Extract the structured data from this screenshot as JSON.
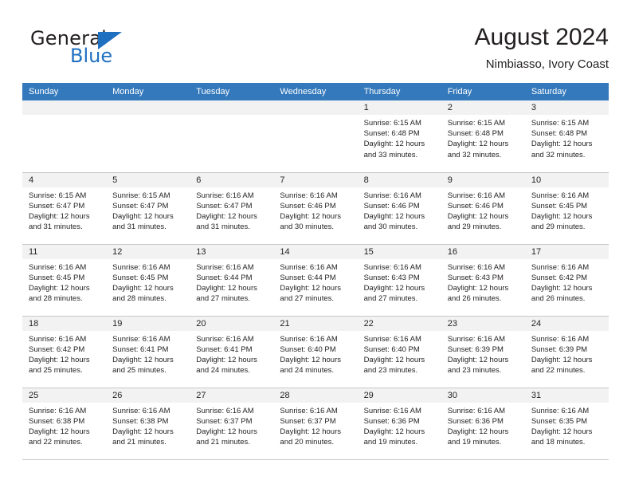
{
  "logo": {
    "word1": "General",
    "word2": "Blue",
    "triangle_color": "#1f70c1",
    "icon": "triangle-logo-icon"
  },
  "header": {
    "title": "August 2024",
    "subtitle": "Nimbiasso, Ivory Coast"
  },
  "calendar": {
    "header_bg": "#3479bb",
    "daynum_bg": "#f2f2f2",
    "weekdays": [
      "Sunday",
      "Monday",
      "Tuesday",
      "Wednesday",
      "Thursday",
      "Friday",
      "Saturday"
    ],
    "weeks": [
      [
        {
          "day": "",
          "sunrise": "",
          "sunset": "",
          "daylight_line1": "",
          "daylight_line2": ""
        },
        {
          "day": "",
          "sunrise": "",
          "sunset": "",
          "daylight_line1": "",
          "daylight_line2": ""
        },
        {
          "day": "",
          "sunrise": "",
          "sunset": "",
          "daylight_line1": "",
          "daylight_line2": ""
        },
        {
          "day": "",
          "sunrise": "",
          "sunset": "",
          "daylight_line1": "",
          "daylight_line2": ""
        },
        {
          "day": "1",
          "sunrise": "Sunrise: 6:15 AM",
          "sunset": "Sunset: 6:48 PM",
          "daylight_line1": "Daylight: 12 hours",
          "daylight_line2": "and 33 minutes."
        },
        {
          "day": "2",
          "sunrise": "Sunrise: 6:15 AM",
          "sunset": "Sunset: 6:48 PM",
          "daylight_line1": "Daylight: 12 hours",
          "daylight_line2": "and 32 minutes."
        },
        {
          "day": "3",
          "sunrise": "Sunrise: 6:15 AM",
          "sunset": "Sunset: 6:48 PM",
          "daylight_line1": "Daylight: 12 hours",
          "daylight_line2": "and 32 minutes."
        }
      ],
      [
        {
          "day": "4",
          "sunrise": "Sunrise: 6:15 AM",
          "sunset": "Sunset: 6:47 PM",
          "daylight_line1": "Daylight: 12 hours",
          "daylight_line2": "and 31 minutes."
        },
        {
          "day": "5",
          "sunrise": "Sunrise: 6:15 AM",
          "sunset": "Sunset: 6:47 PM",
          "daylight_line1": "Daylight: 12 hours",
          "daylight_line2": "and 31 minutes."
        },
        {
          "day": "6",
          "sunrise": "Sunrise: 6:16 AM",
          "sunset": "Sunset: 6:47 PM",
          "daylight_line1": "Daylight: 12 hours",
          "daylight_line2": "and 31 minutes."
        },
        {
          "day": "7",
          "sunrise": "Sunrise: 6:16 AM",
          "sunset": "Sunset: 6:46 PM",
          "daylight_line1": "Daylight: 12 hours",
          "daylight_line2": "and 30 minutes."
        },
        {
          "day": "8",
          "sunrise": "Sunrise: 6:16 AM",
          "sunset": "Sunset: 6:46 PM",
          "daylight_line1": "Daylight: 12 hours",
          "daylight_line2": "and 30 minutes."
        },
        {
          "day": "9",
          "sunrise": "Sunrise: 6:16 AM",
          "sunset": "Sunset: 6:46 PM",
          "daylight_line1": "Daylight: 12 hours",
          "daylight_line2": "and 29 minutes."
        },
        {
          "day": "10",
          "sunrise": "Sunrise: 6:16 AM",
          "sunset": "Sunset: 6:45 PM",
          "daylight_line1": "Daylight: 12 hours",
          "daylight_line2": "and 29 minutes."
        }
      ],
      [
        {
          "day": "11",
          "sunrise": "Sunrise: 6:16 AM",
          "sunset": "Sunset: 6:45 PM",
          "daylight_line1": "Daylight: 12 hours",
          "daylight_line2": "and 28 minutes."
        },
        {
          "day": "12",
          "sunrise": "Sunrise: 6:16 AM",
          "sunset": "Sunset: 6:45 PM",
          "daylight_line1": "Daylight: 12 hours",
          "daylight_line2": "and 28 minutes."
        },
        {
          "day": "13",
          "sunrise": "Sunrise: 6:16 AM",
          "sunset": "Sunset: 6:44 PM",
          "daylight_line1": "Daylight: 12 hours",
          "daylight_line2": "and 27 minutes."
        },
        {
          "day": "14",
          "sunrise": "Sunrise: 6:16 AM",
          "sunset": "Sunset: 6:44 PM",
          "daylight_line1": "Daylight: 12 hours",
          "daylight_line2": "and 27 minutes."
        },
        {
          "day": "15",
          "sunrise": "Sunrise: 6:16 AM",
          "sunset": "Sunset: 6:43 PM",
          "daylight_line1": "Daylight: 12 hours",
          "daylight_line2": "and 27 minutes."
        },
        {
          "day": "16",
          "sunrise": "Sunrise: 6:16 AM",
          "sunset": "Sunset: 6:43 PM",
          "daylight_line1": "Daylight: 12 hours",
          "daylight_line2": "and 26 minutes."
        },
        {
          "day": "17",
          "sunrise": "Sunrise: 6:16 AM",
          "sunset": "Sunset: 6:42 PM",
          "daylight_line1": "Daylight: 12 hours",
          "daylight_line2": "and 26 minutes."
        }
      ],
      [
        {
          "day": "18",
          "sunrise": "Sunrise: 6:16 AM",
          "sunset": "Sunset: 6:42 PM",
          "daylight_line1": "Daylight: 12 hours",
          "daylight_line2": "and 25 minutes."
        },
        {
          "day": "19",
          "sunrise": "Sunrise: 6:16 AM",
          "sunset": "Sunset: 6:41 PM",
          "daylight_line1": "Daylight: 12 hours",
          "daylight_line2": "and 25 minutes."
        },
        {
          "day": "20",
          "sunrise": "Sunrise: 6:16 AM",
          "sunset": "Sunset: 6:41 PM",
          "daylight_line1": "Daylight: 12 hours",
          "daylight_line2": "and 24 minutes."
        },
        {
          "day": "21",
          "sunrise": "Sunrise: 6:16 AM",
          "sunset": "Sunset: 6:40 PM",
          "daylight_line1": "Daylight: 12 hours",
          "daylight_line2": "and 24 minutes."
        },
        {
          "day": "22",
          "sunrise": "Sunrise: 6:16 AM",
          "sunset": "Sunset: 6:40 PM",
          "daylight_line1": "Daylight: 12 hours",
          "daylight_line2": "and 23 minutes."
        },
        {
          "day": "23",
          "sunrise": "Sunrise: 6:16 AM",
          "sunset": "Sunset: 6:39 PM",
          "daylight_line1": "Daylight: 12 hours",
          "daylight_line2": "and 23 minutes."
        },
        {
          "day": "24",
          "sunrise": "Sunrise: 6:16 AM",
          "sunset": "Sunset: 6:39 PM",
          "daylight_line1": "Daylight: 12 hours",
          "daylight_line2": "and 22 minutes."
        }
      ],
      [
        {
          "day": "25",
          "sunrise": "Sunrise: 6:16 AM",
          "sunset": "Sunset: 6:38 PM",
          "daylight_line1": "Daylight: 12 hours",
          "daylight_line2": "and 22 minutes."
        },
        {
          "day": "26",
          "sunrise": "Sunrise: 6:16 AM",
          "sunset": "Sunset: 6:38 PM",
          "daylight_line1": "Daylight: 12 hours",
          "daylight_line2": "and 21 minutes."
        },
        {
          "day": "27",
          "sunrise": "Sunrise: 6:16 AM",
          "sunset": "Sunset: 6:37 PM",
          "daylight_line1": "Daylight: 12 hours",
          "daylight_line2": "and 21 minutes."
        },
        {
          "day": "28",
          "sunrise": "Sunrise: 6:16 AM",
          "sunset": "Sunset: 6:37 PM",
          "daylight_line1": "Daylight: 12 hours",
          "daylight_line2": "and 20 minutes."
        },
        {
          "day": "29",
          "sunrise": "Sunrise: 6:16 AM",
          "sunset": "Sunset: 6:36 PM",
          "daylight_line1": "Daylight: 12 hours",
          "daylight_line2": "and 19 minutes."
        },
        {
          "day": "30",
          "sunrise": "Sunrise: 6:16 AM",
          "sunset": "Sunset: 6:36 PM",
          "daylight_line1": "Daylight: 12 hours",
          "daylight_line2": "and 19 minutes."
        },
        {
          "day": "31",
          "sunrise": "Sunrise: 6:16 AM",
          "sunset": "Sunset: 6:35 PM",
          "daylight_line1": "Daylight: 12 hours",
          "daylight_line2": "and 18 minutes."
        }
      ]
    ]
  }
}
